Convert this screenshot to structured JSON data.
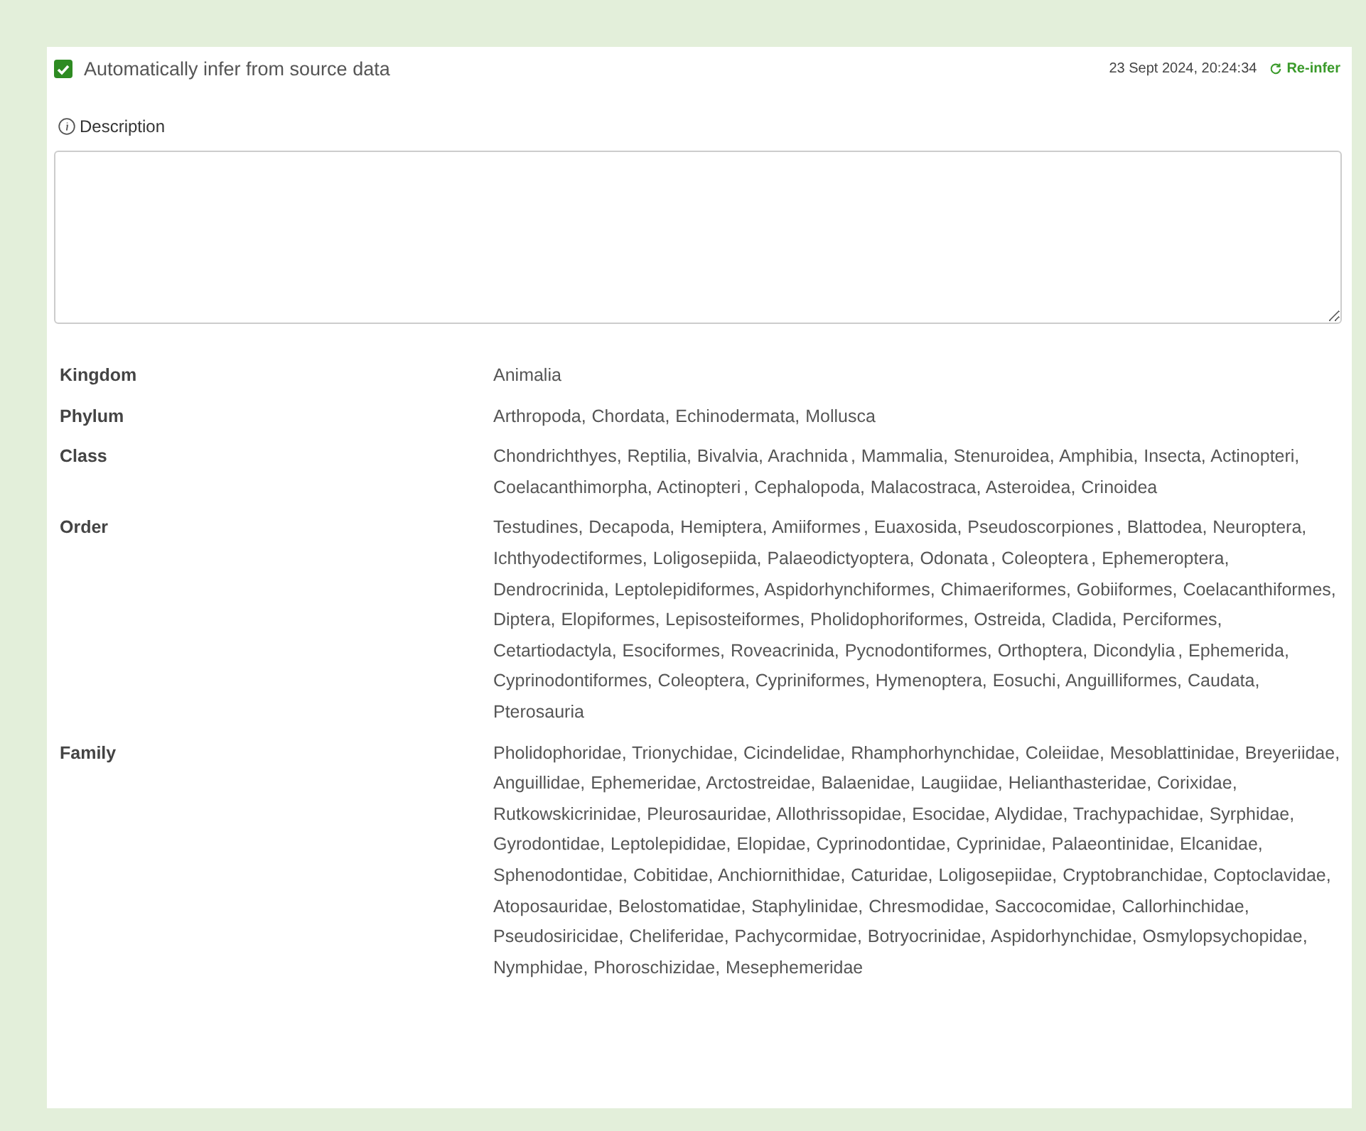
{
  "auto_infer": {
    "label": "Automatically infer from source data",
    "checked": true
  },
  "timestamp": "23 Sept 2024, 20:24:34",
  "reinfer_link": "Re-infer",
  "description": {
    "label": "Description"
  },
  "taxonomy": [
    {
      "label": "Kingdom",
      "value": "Animalia"
    },
    {
      "label": "Phylum",
      "value": "Arthropoda,  Chordata,  Echinodermata,  Mollusca"
    },
    {
      "label": "Class",
      "value": "Chondrichthyes,  Reptilia,  Bivalvia,  Arachnida ,  Mammalia,  Stenuroidea,  Amphibia,  Insecta,  Actinopteri,  Coelacanthimorpha,  Actinopteri ,  Cephalopoda,  Malacostraca,  Asteroidea,  Crinoidea"
    },
    {
      "label": "Order",
      "value": "Testudines,  Decapoda,  Hemiptera,  Amiiformes ,  Euaxosida,  Pseudoscorpiones ,  Blattodea,  Neuroptera,  Ichthyodectiformes,  Loligosepiida,  Palaeodictyoptera,  Odonata ,  Coleoptera ,  Ephemeroptera,  Dendrocrinida,  Leptolepidiformes,  Aspidorhynchiformes,  Chimaeriformes,  Gobiiformes,  Coelacanthiformes,  Diptera,  Elopiformes,  Lepisosteiformes,  Pholidophoriformes,  Ostreida,  Cladida,  Perciformes,  Cetartiodactyla,  Esociformes,  Roveacrinida,  Pycnodontiformes,  Orthoptera,  Dicondylia ,  Ephemerida,  Cyprinodontiformes,  Coleoptera,  Cypriniformes,  Hymenoptera,  Eosuchi,  Anguilliformes,  Caudata,  Pterosauria"
    },
    {
      "label": "Family",
      "value": "Pholidophoridae,  Trionychidae,  Cicindelidae,  Rhamphorhynchidae,  Coleiidae,  Mesoblattinidae,  Breyeriidae,  Anguillidae,  Ephemeridae,  Arctostreidae,  Balaenidae,  Laugiidae,  Helianthasteridae,  Corixidae,  Rutkowskicrinidae,  Pleurosauridae,  Allothrissopidae,  Esocidae,  Alydidae,  Trachypachidae,  Syrphidae,  Gyrodontidae,  Leptolepididae,  Elopidae,  Cyprinodontidae,  Cyprinidae,  Palaeontinidae,  Elcanidae,  Sphenodontidae,  Cobitidae,  Anchiornithidae,  Caturidae,  Loligosepiidae,  Cryptobranchidae,  Coptoclavidae,  Atoposauridae,  Belostomatidae,  Staphylinidae,  Chresmodidae,  Saccocomidae,  Callorhinchidae,  Pseudosiricidae,  Cheliferidae,  Pachycormidae,  Botryocrinidae,  Aspidorhynchidae,  Osmylopsychopidae,  Nymphidae,  Phoroschizidae,  Mesephemeridae"
    }
  ]
}
